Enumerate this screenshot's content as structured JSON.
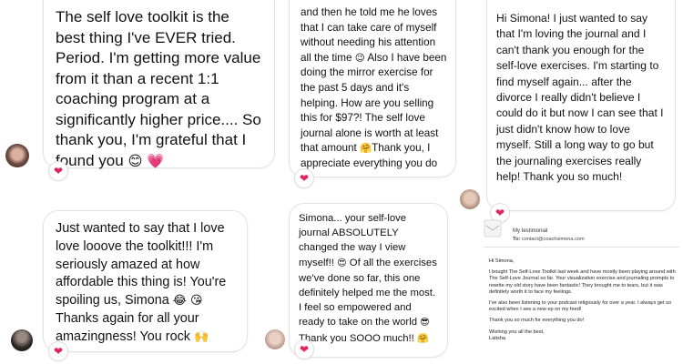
{
  "bubbles": {
    "b1": {
      "text": "The self love toolkit is the best thing I've EVER tried. Period. I'm getting more value from it than a recent 1:1 coaching program at a significantly higher price.... So thank you, I'm grateful that I found you",
      "emojis": "😊 💗"
    },
    "b2": {
      "text_a": "Just wanted to say that I love love looove the toolkit!!! I'm seriously amazed at how affordable this thing is! You're spoiling us, Simona",
      "emojis_a": "😂 😘",
      "text_b": " Thanks again for all your amazingness! You rock",
      "emojis_b": "🙌"
    },
    "b3": {
      "text_a": "and then he told me he loves that I can take care of myself without needing his attention all the time",
      "emoji_a": "😉",
      "text_b": " Also I have been doing the mirror exercise for the past 5 days and it's helping. How are you selling this for $97?! The self love journal alone is worth at least that amount",
      "emoji_b": "🤗",
      "text_c": "Thank you, I appreciate everything you do",
      "emoji_c": "💕"
    },
    "b4": {
      "text_a": "Simona... your self-love journal ABSOLUTELY changed the way I view myself!!",
      "emoji_a": "😍",
      "text_b": " Of all the exercises we've done so far, this one definitely helped me the most. I feel so empowered and ready to take on the world",
      "emoji_b": "😎",
      "text_c": " Thank you SOOO much!!",
      "emoji_c": "🤗"
    },
    "b5": {
      "text": "Hi Simona! I just wanted to say that I'm loving the journal and I can't thank you enough for the self-love exercises. I'm starting to find myself again... after the divorce I really didn't believe I could do it but now I can see that I just didn't know how to love myself. Still a long way to go but the journaling exercises really help! Thank you so much!"
    }
  },
  "heart_icon": "❤",
  "email": {
    "subject": "My testimonial",
    "to_label": "To:",
    "to_value": "contact@coachsimona.com",
    "greeting": "Hi Simona,",
    "p1": "I bought The Self-Love Toolkit last week and have mostly been playing around with The Self-Love Journal so far. Your visualization exercise and journaling prompts to rewrite my old story have been fantastic! They brought me to tears, but it was definitely worth it to face my feelings.",
    "p2": "I've also been listening to your podcast religiously for over a year. I always get so excited when I see a new ep on my feed!",
    "p3": "Thank you so much for everything you do!",
    "sign1": "Wishing you all the best,",
    "sign2": "Latisha"
  },
  "colors": {
    "heart": "#e0245e",
    "bubble_border": "#e3e3e3"
  }
}
